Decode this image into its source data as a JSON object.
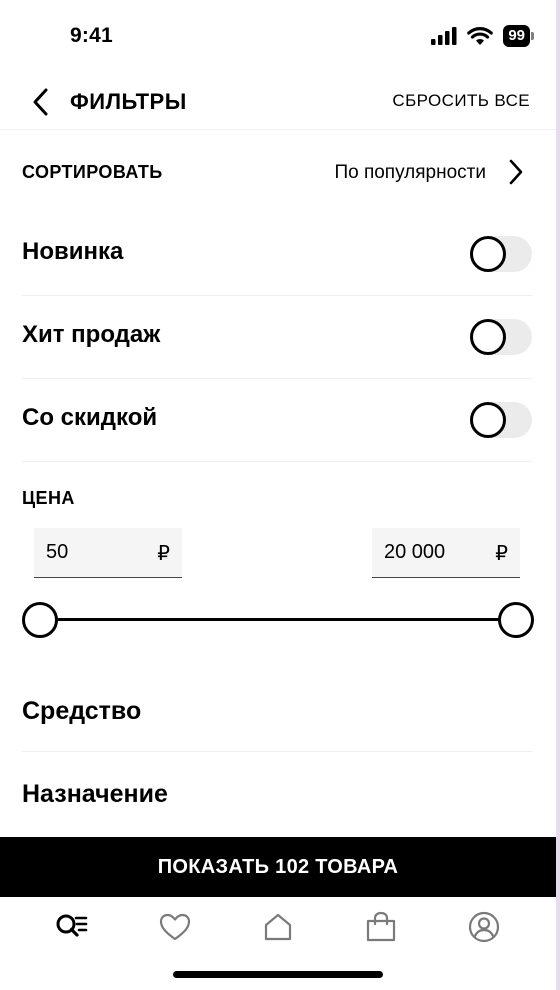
{
  "status_bar": {
    "time": "9:41",
    "battery": "99"
  },
  "header": {
    "title": "ФИЛЬТРЫ",
    "reset_label": "СБРОСИТЬ ВСЕ"
  },
  "sort": {
    "label": "СОРТИРОВАТЬ",
    "value": "По популярности"
  },
  "toggles": [
    {
      "label": "Новинка",
      "on": false
    },
    {
      "label": "Хит продаж",
      "on": false
    },
    {
      "label": "Со скидкой",
      "on": false
    }
  ],
  "price": {
    "label": "ЦЕНА",
    "min_value": "50",
    "max_value": "20 000",
    "currency": "₽"
  },
  "sections": [
    {
      "label": "Средство"
    },
    {
      "label": "Назначение"
    }
  ],
  "show_button": {
    "label": "ПОКАЗАТЬ 102 ТОВАРА"
  },
  "tabbar": {
    "icons": [
      "search-list-icon",
      "heart-icon",
      "home-icon",
      "shopping-bag-icon",
      "profile-icon"
    ],
    "active_index": 0
  },
  "colors": {
    "accent": "#000000",
    "toggle_track": "#ebebeb",
    "field_bg": "#f5f5f5"
  }
}
